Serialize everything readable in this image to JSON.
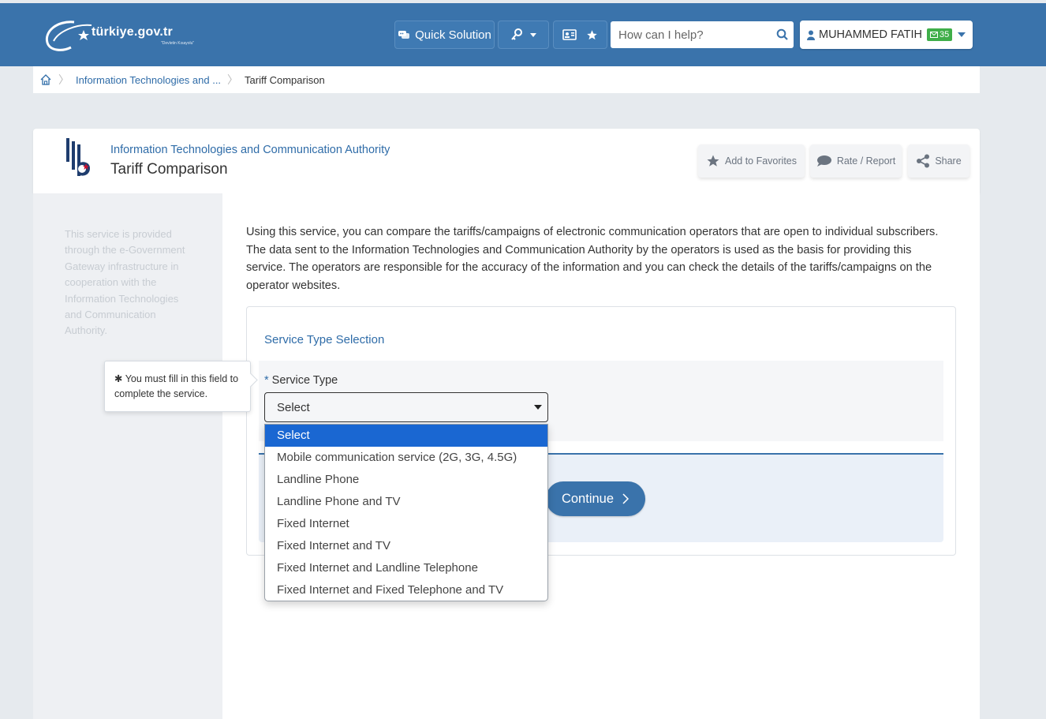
{
  "header": {
    "logo_text": "türkiye.gov.tr",
    "logo_tagline": "\"Devletin Kısayolu\"",
    "quick_solution": "Quick Solution",
    "search_placeholder": "How can I help?",
    "user_name": "MUHAMMED FATIH",
    "message_count": "35"
  },
  "breadcrumb": {
    "items": [
      "Information Technologies and ...",
      "Tariff Comparison"
    ]
  },
  "page": {
    "institution": "Information Technologies and Communication Authority",
    "title": "Tariff Comparison",
    "actions": {
      "favorites": "Add to Favorites",
      "rate": "Rate / Report",
      "share": "Share"
    },
    "sidebar_note": "This service is provided through the e-Government Gateway infrastructure in cooperation with the Information Technologies and Communication Authority.",
    "intro": "Using this service, you can compare the tariffs/campaigns of electronic communication operators that are open to individual subscribers. The data sent to the Information Technologies and Communication Authority by the operators is used as the basis for providing this service. The operators are responsible for the accuracy of the information and you can check the details of the tariffs/campaigns on the operator websites."
  },
  "form": {
    "section_title": "Service Type Selection",
    "required_mark": "*",
    "field_label": "Service Type",
    "selected_value": "Select",
    "tooltip": "✱ You must fill in this field to complete the service.",
    "continue_label": "Continue",
    "options": [
      "Select",
      "Mobile communication service (2G, 3G, 4.5G)",
      "Landline Phone",
      "Landline Phone and TV",
      "Fixed Internet",
      "Fixed Internet and TV",
      "Fixed Internet and Landline Telephone",
      "Fixed Internet and Fixed Telephone and TV"
    ],
    "highlighted_option": "Select"
  },
  "colors": {
    "header_bg": "#3a73ab",
    "link": "#2f6ca8",
    "badge_green": "#3fae49",
    "option_highlight": "#1a67d2"
  }
}
